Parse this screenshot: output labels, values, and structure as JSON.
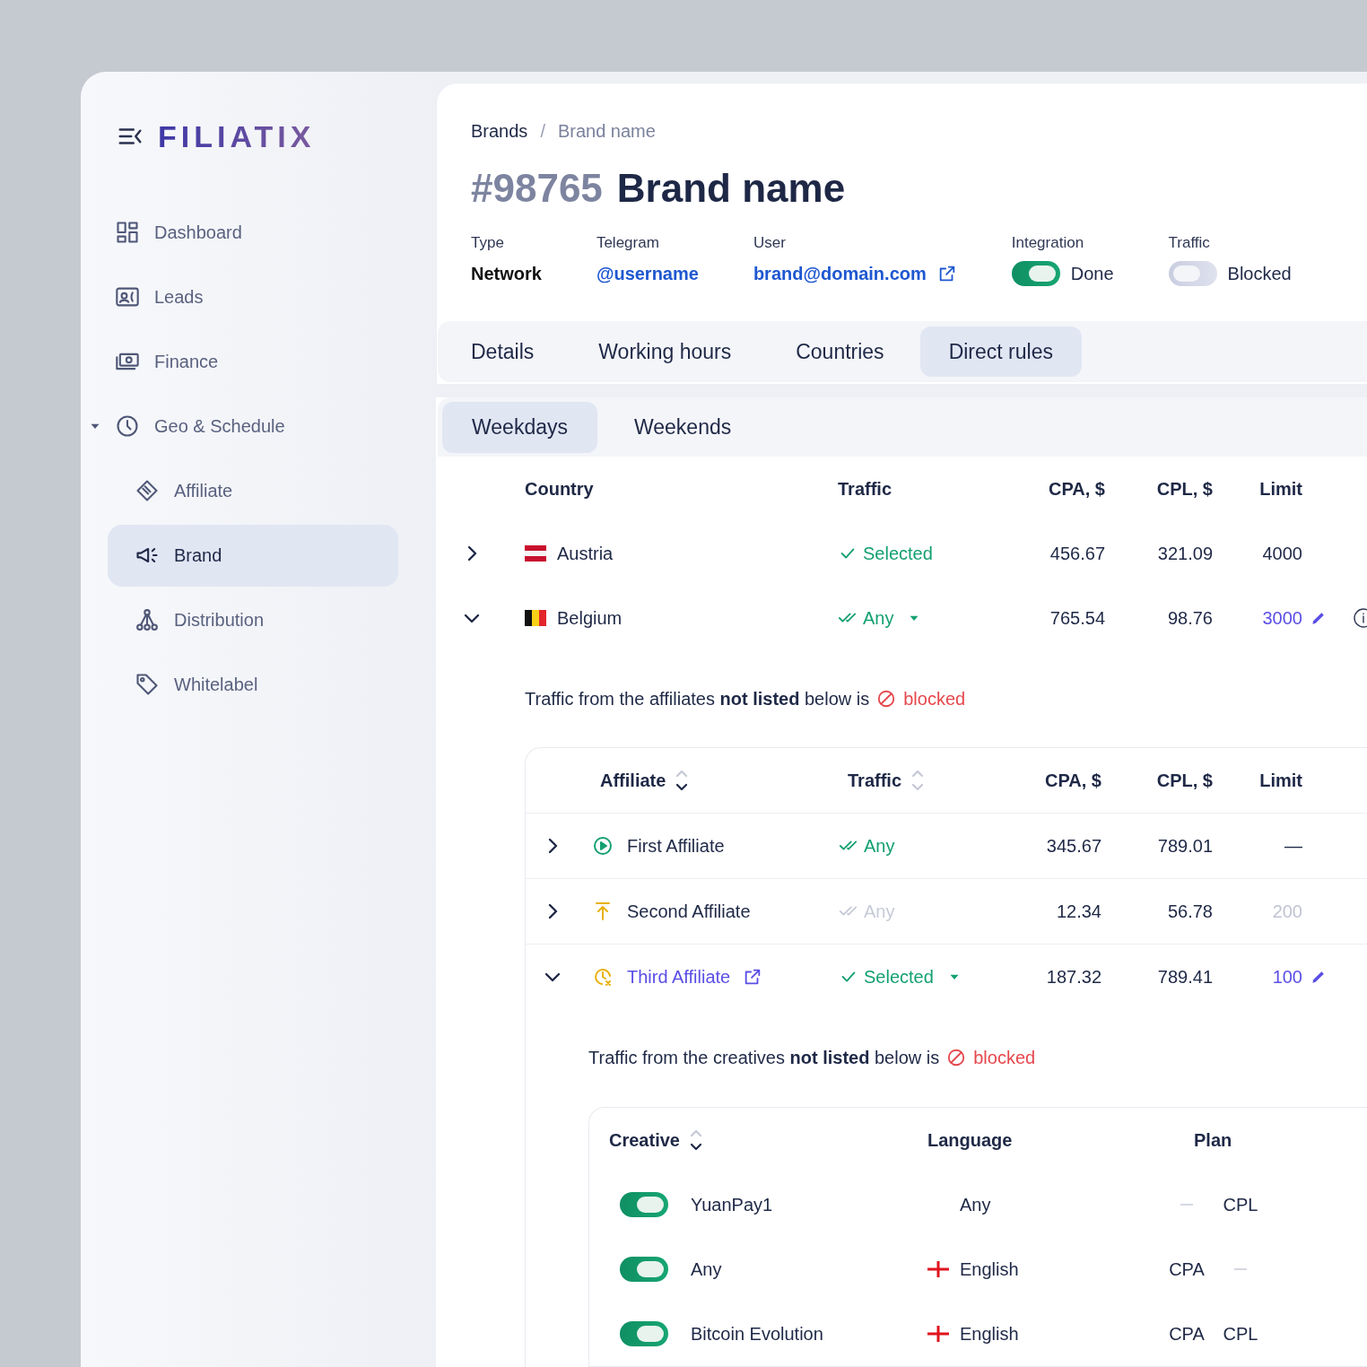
{
  "sidebar": {
    "logo": "FILIATIX",
    "items": [
      {
        "label": "Dashboard",
        "selected": false
      },
      {
        "label": "Leads",
        "selected": false
      },
      {
        "label": "Finance",
        "selected": false
      },
      {
        "label": "Geo & Schedule",
        "selected": false,
        "expanded": true,
        "children": [
          {
            "label": "Affiliate",
            "selected": false
          },
          {
            "label": "Brand",
            "selected": true
          },
          {
            "label": "Distribution",
            "selected": false
          },
          {
            "label": "Whitelabel",
            "selected": false
          }
        ]
      }
    ]
  },
  "header": {
    "breadcrumb": [
      {
        "label": "Brands",
        "current": false
      },
      {
        "label": "Brand name",
        "current": true
      }
    ],
    "separator": "/",
    "id": "#98765",
    "title": "Brand name",
    "fields": [
      {
        "kind": "text",
        "label": "Type",
        "value": "Network"
      },
      {
        "kind": "link",
        "label": "Telegram",
        "value": "@username"
      },
      {
        "kind": "external_link",
        "label": "User",
        "value": "brand@domain.com"
      },
      {
        "kind": "toggle",
        "label": "Integration",
        "on": true,
        "value": "Done"
      },
      {
        "kind": "toggle",
        "label": "Traffic",
        "on": false,
        "value": "Blocked"
      }
    ],
    "tabs": [
      {
        "label": "Details",
        "selected": false
      },
      {
        "label": "Working hours",
        "selected": false
      },
      {
        "label": "Countries",
        "selected": false
      },
      {
        "label": "Direct rules",
        "selected": true
      }
    ]
  },
  "subtabs": [
    {
      "label": "Weekdays",
      "selected": true
    },
    {
      "label": "Weekends",
      "selected": false
    }
  ],
  "countries": {
    "columns": [
      "Country",
      "Traffic",
      "CPA, $",
      "CPL, $",
      "Limit"
    ],
    "rows": [
      {
        "expanded": false,
        "name": "Austria",
        "traffic": {
          "kind": "selected",
          "label": "Selected",
          "dropdown": false
        },
        "cpa": "456.67",
        "cpl": "321.09",
        "limit": "4000",
        "limit_editable": false,
        "info": false
      },
      {
        "expanded": true,
        "name": "Belgium",
        "traffic": {
          "kind": "any",
          "label": "Any",
          "dropdown": true
        },
        "cpa": "765.54",
        "cpl": "98.76",
        "limit": "3000",
        "limit_editable": true,
        "info": true,
        "detail": {
          "note": {
            "text": "Traffic from the affiliates **not listed** below is",
            "status": "blocked"
          },
          "affiliates": {
            "columns": [
              {
                "label": "Affiliate",
                "sorted": true
              },
              {
                "label": "Traffic",
                "sorted": false
              },
              {
                "label": "CPA, $"
              },
              {
                "label": "CPL, $"
              },
              {
                "label": "Limit"
              }
            ],
            "rows": [
              {
                "kind": "play",
                "expanded": false,
                "name": "First Affiliate",
                "link": false,
                "traffic": {
                  "kind": "any",
                  "label": "Any",
                  "dropdown": false
                },
                "cpa": "345.67",
                "cpl": "789.01",
                "limit": "—",
                "limit_editable": false,
                "disabled": false
              },
              {
                "kind": "upload",
                "expanded": false,
                "name": "Second Affiliate",
                "link": false,
                "traffic": {
                  "kind": "any",
                  "label": "Any",
                  "dropdown": false
                },
                "cpa": "12.34",
                "cpl": "56.78",
                "limit": "200",
                "limit_editable": false,
                "disabled": true
              },
              {
                "kind": "clock",
                "expanded": true,
                "name": "Third Affiliate",
                "link": true,
                "traffic": {
                  "kind": "selected",
                  "label": "Selected",
                  "dropdown": true
                },
                "cpa": "187.32",
                "cpl": "789.41",
                "limit": "100",
                "limit_editable": true,
                "disabled": false,
                "detail": {
                  "note": {
                    "text": "Traffic from the creatives **not listed** below is",
                    "status": "blocked"
                  },
                  "creatives": {
                    "columns": [
                      {
                        "label": "Creative",
                        "sorted": true
                      },
                      {
                        "label": "Language"
                      },
                      {
                        "label": "Plan"
                      }
                    ],
                    "rows": [
                      {
                        "enabled": true,
                        "name": "YuanPay1",
                        "language": {
                          "label": "Any",
                          "flag": false
                        },
                        "plan": {
                          "cpl": "CPL"
                        }
                      },
                      {
                        "enabled": true,
                        "name": "Any",
                        "language": {
                          "label": "English",
                          "flag": true
                        },
                        "plan": {
                          "cpa": "CPA"
                        }
                      },
                      {
                        "enabled": true,
                        "name": "Bitcoin Evolution",
                        "language": {
                          "label": "English",
                          "flag": true
                        },
                        "plan": {
                          "cpa": "CPA",
                          "cpl": "CPL"
                        }
                      }
                    ]
                  }
                }
              }
            ]
          }
        }
      }
    ]
  }
}
